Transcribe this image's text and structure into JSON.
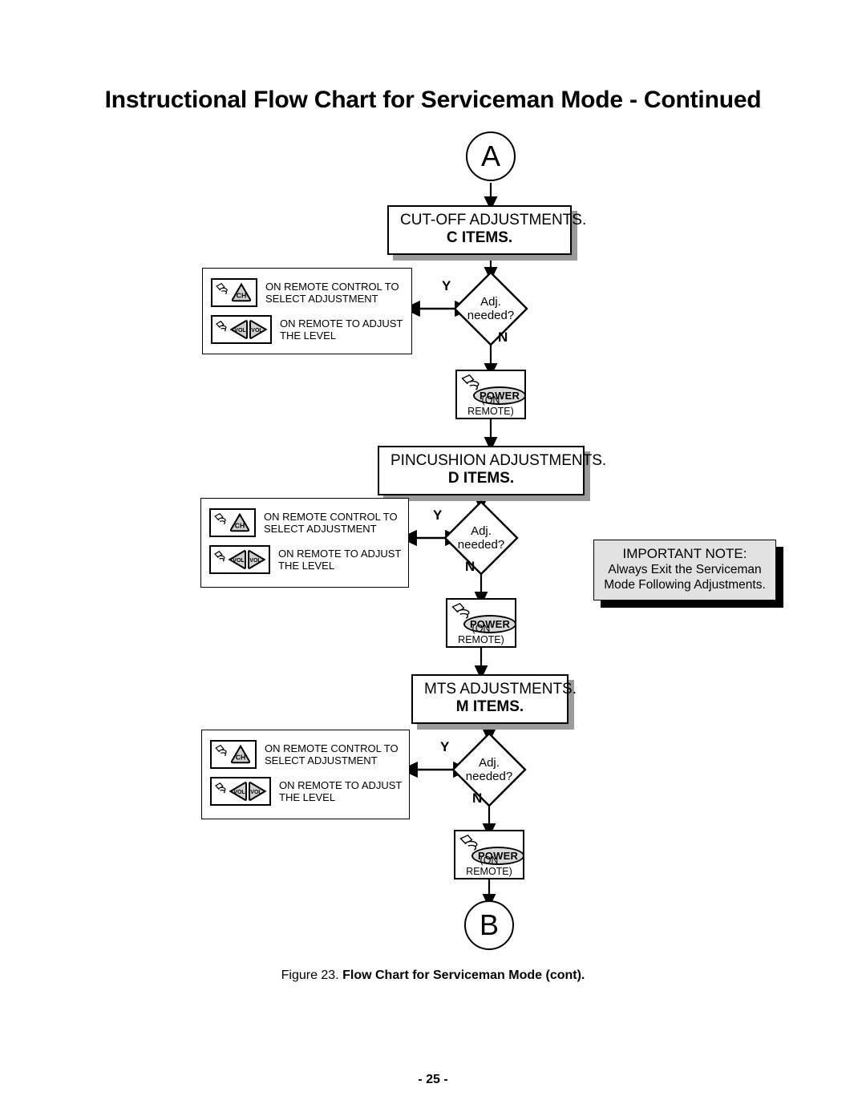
{
  "document": {
    "title": "Instructional Flow Chart for Serviceman Mode - Continued",
    "figure_caption_number": "Figure 23.",
    "figure_caption_title": "Flow Chart for Serviceman Mode (cont).",
    "page_number": "- 25 -"
  },
  "connectors": {
    "entry": "A",
    "exit": "B"
  },
  "sections": [
    {
      "process_line1": "CUT-OFF ADJUSTMENTS.",
      "process_line2": "C ITEMS.",
      "decision_line1": "Adj.",
      "decision_line2": "needed?",
      "yes_label": "Y",
      "no_label": "N",
      "instruction_rows": [
        {
          "keys": [
            "CH"
          ],
          "text_line1": "ON REMOTE CONTROL TO",
          "text_line2": "SELECT ADJUSTMENT"
        },
        {
          "keys": [
            "VOL",
            "VOL"
          ],
          "text_line1": "ON REMOTE TO ADJUST",
          "text_line2": "THE LEVEL"
        }
      ],
      "power_label": "POWER",
      "power_sub": "(ON REMOTE)"
    },
    {
      "process_line1": "PINCUSHION ADJUSTMENTS.",
      "process_line2": "D ITEMS.",
      "decision_line1": "Adj.",
      "decision_line2": "needed?",
      "yes_label": "Y",
      "no_label": "N",
      "instruction_rows": [
        {
          "keys": [
            "CH"
          ],
          "text_line1": "ON REMOTE CONTROL TO",
          "text_line2": "SELECT ADJUSTMENT"
        },
        {
          "keys": [
            "VOL",
            "VOL"
          ],
          "text_line1": "ON REMOTE TO ADJUST",
          "text_line2": "THE LEVEL"
        }
      ],
      "power_label": "POWER",
      "power_sub": "(ON REMOTE)"
    },
    {
      "process_line1": "MTS ADJUSTMENTS.",
      "process_line2": "M ITEMS.",
      "decision_line1": "Adj.",
      "decision_line2": "needed?",
      "yes_label": "Y",
      "no_label": "N",
      "instruction_rows": [
        {
          "keys": [
            "CH"
          ],
          "text_line1": "ON REMOTE CONTROL TO",
          "text_line2": "SELECT ADJUSTMENT"
        },
        {
          "keys": [
            "VOL",
            "VOL"
          ],
          "text_line1": "ON REMOTE TO ADJUST",
          "text_line2": "THE LEVEL"
        }
      ],
      "power_label": "POWER",
      "power_sub": "(ON REMOTE)"
    }
  ],
  "note": {
    "title": "IMPORTANT NOTE:",
    "line1": "Always Exit the Serviceman",
    "line2": "Mode Following Adjustments."
  },
  "colors": {
    "ink": "#000000",
    "paper": "#ffffff",
    "box_shadow_gray": "#9a9a9a",
    "note_fill": "#e2e2e2",
    "key_fill": "#cfcfcf",
    "power_fill": "#d9d9d9"
  }
}
